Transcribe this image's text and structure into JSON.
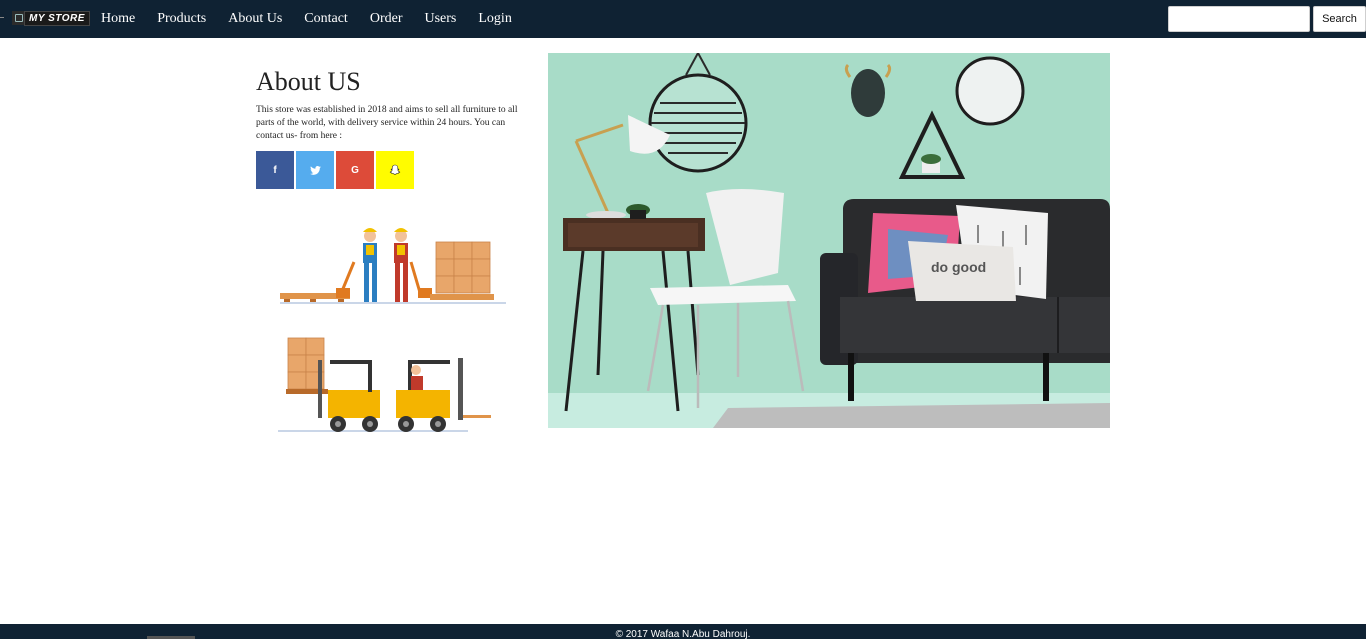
{
  "brand": {
    "name": "MY STORE"
  },
  "nav": {
    "items": [
      {
        "label": "Home"
      },
      {
        "label": "Products"
      },
      {
        "label": "About Us"
      },
      {
        "label": "Contact"
      },
      {
        "label": "Order"
      },
      {
        "label": "Users"
      },
      {
        "label": "Login"
      }
    ]
  },
  "search": {
    "value": "",
    "button_label": "Search"
  },
  "about": {
    "title": "About US",
    "text": "This store was established in 2018 and aims to sell all furniture to all parts of the world, with delivery service within 24 hours. You can contact us- from here :"
  },
  "social": [
    {
      "name": "facebook",
      "glyph": "f",
      "color": "#3b5998"
    },
    {
      "name": "twitter",
      "glyph": "t",
      "color": "#55acee"
    },
    {
      "name": "google",
      "glyph": "G",
      "color": "#dd4b39"
    },
    {
      "name": "snapchat",
      "glyph": "ghost",
      "color": "#fffc00"
    }
  ],
  "hero": {
    "pillow_text": "do good"
  },
  "footer": {
    "text": "© 2017 Wafaa N.Abu Dahrouj."
  },
  "colors": {
    "navbar": "#0f2233",
    "hero_wall": "#a8dcc8"
  }
}
